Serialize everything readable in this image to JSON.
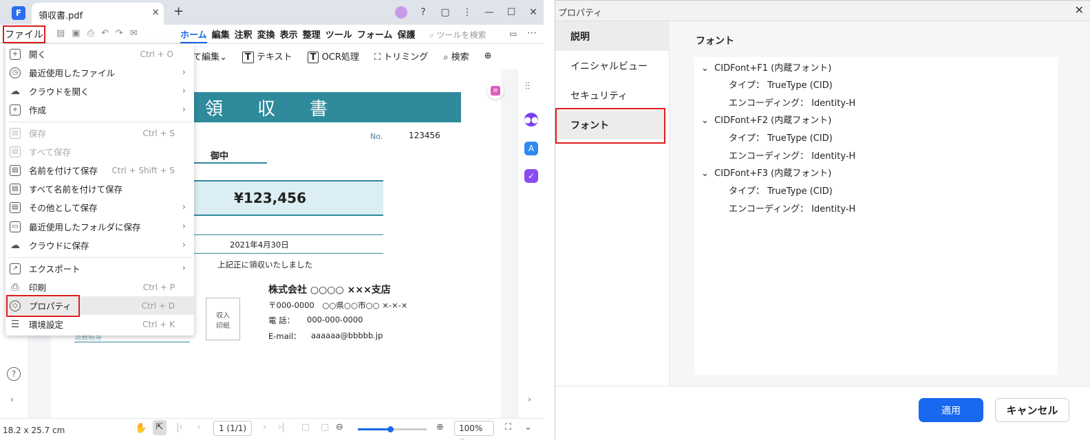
{
  "window": {
    "tab_title": "領収書.pdf",
    "tab_close": "×",
    "new_tab": "+",
    "controls": [
      "?",
      "▢",
      "⋮",
      "—",
      "☐",
      "✕"
    ]
  },
  "menubar": {
    "file": "ファイル",
    "tabs": [
      "ホーム",
      "編集",
      "注釈",
      "変換",
      "表示",
      "整理",
      "ツール",
      "フォーム",
      "保護"
    ],
    "search_placeholder": "ツールを検索",
    "more": "⋯"
  },
  "toolbar": {
    "edit_all": "て編集",
    "text": "テキスト",
    "ocr": "OCR処理",
    "trim": "トリミング",
    "search": "検索"
  },
  "file_menu": {
    "items": [
      {
        "label": "開く",
        "shortcut": "Ctrl + O",
        "icon": "+"
      },
      {
        "label": "最近使用したファイル",
        "arrow": "›",
        "icon": "◷"
      },
      {
        "label": "クラウドを開く",
        "arrow": "›",
        "icon": "☁"
      },
      {
        "label": "作成",
        "arrow": "›",
        "icon": "+"
      },
      {
        "label": "保存",
        "shortcut": "Ctrl + S",
        "icon": "▤"
      },
      {
        "label": "すべて保存",
        "icon": "▤"
      },
      {
        "label": "名前を付けて保存",
        "shortcut": "Ctrl + Shift + S",
        "icon": "▤"
      },
      {
        "label": "すべて名前を付けて保存",
        "icon": "▤"
      },
      {
        "label": "その他として保存",
        "arrow": "›",
        "icon": "▤"
      },
      {
        "label": "最近使用したフォルダに保存",
        "arrow": "›",
        "icon": "▭"
      },
      {
        "label": "クラウドに保存",
        "arrow": "›",
        "icon": "☁"
      },
      {
        "label": "エクスポート",
        "arrow": "›",
        "icon": "↗"
      },
      {
        "label": "印刷",
        "shortcut": "Ctrl + P",
        "icon": "⎙"
      },
      {
        "label": "プロパティ",
        "shortcut": "Ctrl + D",
        "icon": "◇"
      },
      {
        "label": "環境設定",
        "shortcut": "Ctrl + K",
        "icon": "☰"
      }
    ]
  },
  "receipt": {
    "title": "領収書",
    "no_label": "No.",
    "no_value": "123456",
    "recipient": "御中",
    "amount": "¥123,456",
    "date": "2021年4月30日",
    "note": "上記正に領収いたしました",
    "company": "株式会社 ○○○○ ×××支店",
    "postal": "〒000-0000　○○県○○市○○ ×-×-×",
    "phone_label": "電 話：",
    "phone": "000-000-0000",
    "email_label": "E-mail：",
    "email": "aaaaaa@bbbbb.jp",
    "stamp": "収入\n印紙",
    "tax_label": "消費税等"
  },
  "statusbar": {
    "size": "18.2 x 25.7 cm",
    "page": "1 (1/1)",
    "zoom": "100%",
    "zoom_progress": 0.47
  },
  "dialog": {
    "title": "プロパティ",
    "close": "✕",
    "nav": [
      "説明",
      "イニシャルビュー",
      "セキュリティ",
      "フォント"
    ],
    "section_title": "フォント",
    "fonts": [
      {
        "name": "CIDFont+F1 (内蔵フォント)",
        "type": "タイプ： TrueType (CID)",
        "encoding": "エンコーディング： Identity-H"
      },
      {
        "name": "CIDFont+F2 (内蔵フォント)",
        "type": "タイプ： TrueType (CID)",
        "encoding": "エンコーディング： Identity-H"
      },
      {
        "name": "CIDFont+F3 (内蔵フォント)",
        "type": "タイプ： TrueType (CID)",
        "encoding": "エンコーディング： Identity-H"
      }
    ],
    "apply": "適用",
    "cancel": "キャンセル"
  },
  "colors": {
    "accent": "#1565e8",
    "highlight_box": "#e01b1b",
    "receipt_header": "#2f8a9b",
    "apply_button": "#1868f0"
  }
}
